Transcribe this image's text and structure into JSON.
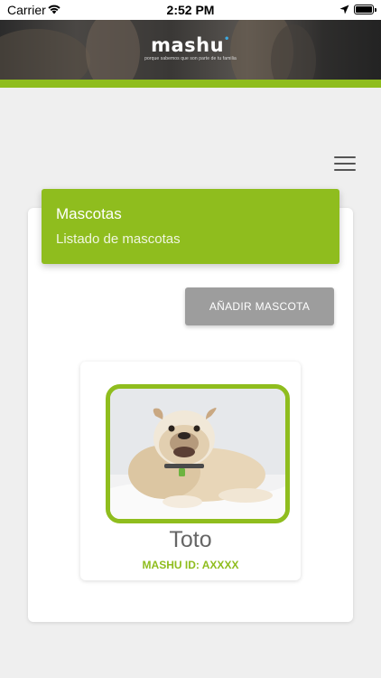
{
  "status_bar": {
    "carrier": "Carrier",
    "time": "2:52 PM",
    "icons": [
      "wifi-icon",
      "location-icon",
      "battery-icon"
    ]
  },
  "header": {
    "logo_text": "mashu",
    "tagline": "porque sabemos que son parte de tu familia"
  },
  "menu": {
    "icon": "hamburger-menu-icon"
  },
  "card": {
    "title": "Mascotas",
    "subtitle": "Listado de mascotas",
    "add_button_label": "AÑADIR MASCOTA"
  },
  "pets": [
    {
      "name": "Toto",
      "mashu_id_label": "MASHU ID: AXXXX",
      "photo": "bulldog-photo"
    }
  ],
  "colors": {
    "accent": "#8fbd1e",
    "button_gray": "#9d9d9d",
    "background": "#efefef"
  }
}
